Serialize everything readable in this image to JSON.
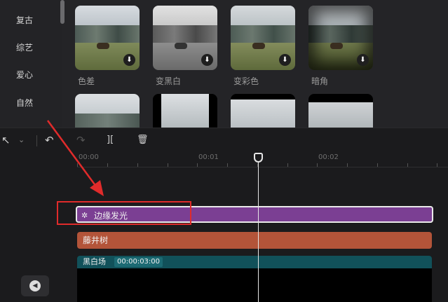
{
  "categories": [
    "复古",
    "综艺",
    "爱心",
    "自然"
  ],
  "effects_row1": [
    {
      "label": "色差",
      "tone": "color"
    },
    {
      "label": "变黑白",
      "tone": "gray"
    },
    {
      "label": "变彩色",
      "tone": "color"
    },
    {
      "label": "暗角",
      "tone": "vignette"
    }
  ],
  "icons": {
    "download": "download-icon",
    "cursor": "cursor-icon",
    "undo": "undo-icon",
    "redo": "redo-icon",
    "split": "split-icon",
    "delete": "trash-icon",
    "mute": "speaker-icon",
    "effect": "sparkle-icon"
  },
  "toolbar": {
    "cursor_glyph": "↖",
    "chevron_glyph": "⌄",
    "undo_glyph": "↶",
    "redo_glyph": "↷",
    "split_glyph": "][",
    "delete_glyph": "🗑"
  },
  "ruler": {
    "ticks": [
      "00:00",
      "00:01",
      "00:02"
    ]
  },
  "timeline": {
    "effect_clip": "边缘发光",
    "audio_clip": "藤井树",
    "video_clip_name": "黑白场",
    "video_clip_duration": "00:00:03:00"
  },
  "colors": {
    "effect_clip": "#7b3f93",
    "audio_clip": "#b35439",
    "video_clip_bar": "#11515a",
    "highlight": "#e02b2b"
  }
}
